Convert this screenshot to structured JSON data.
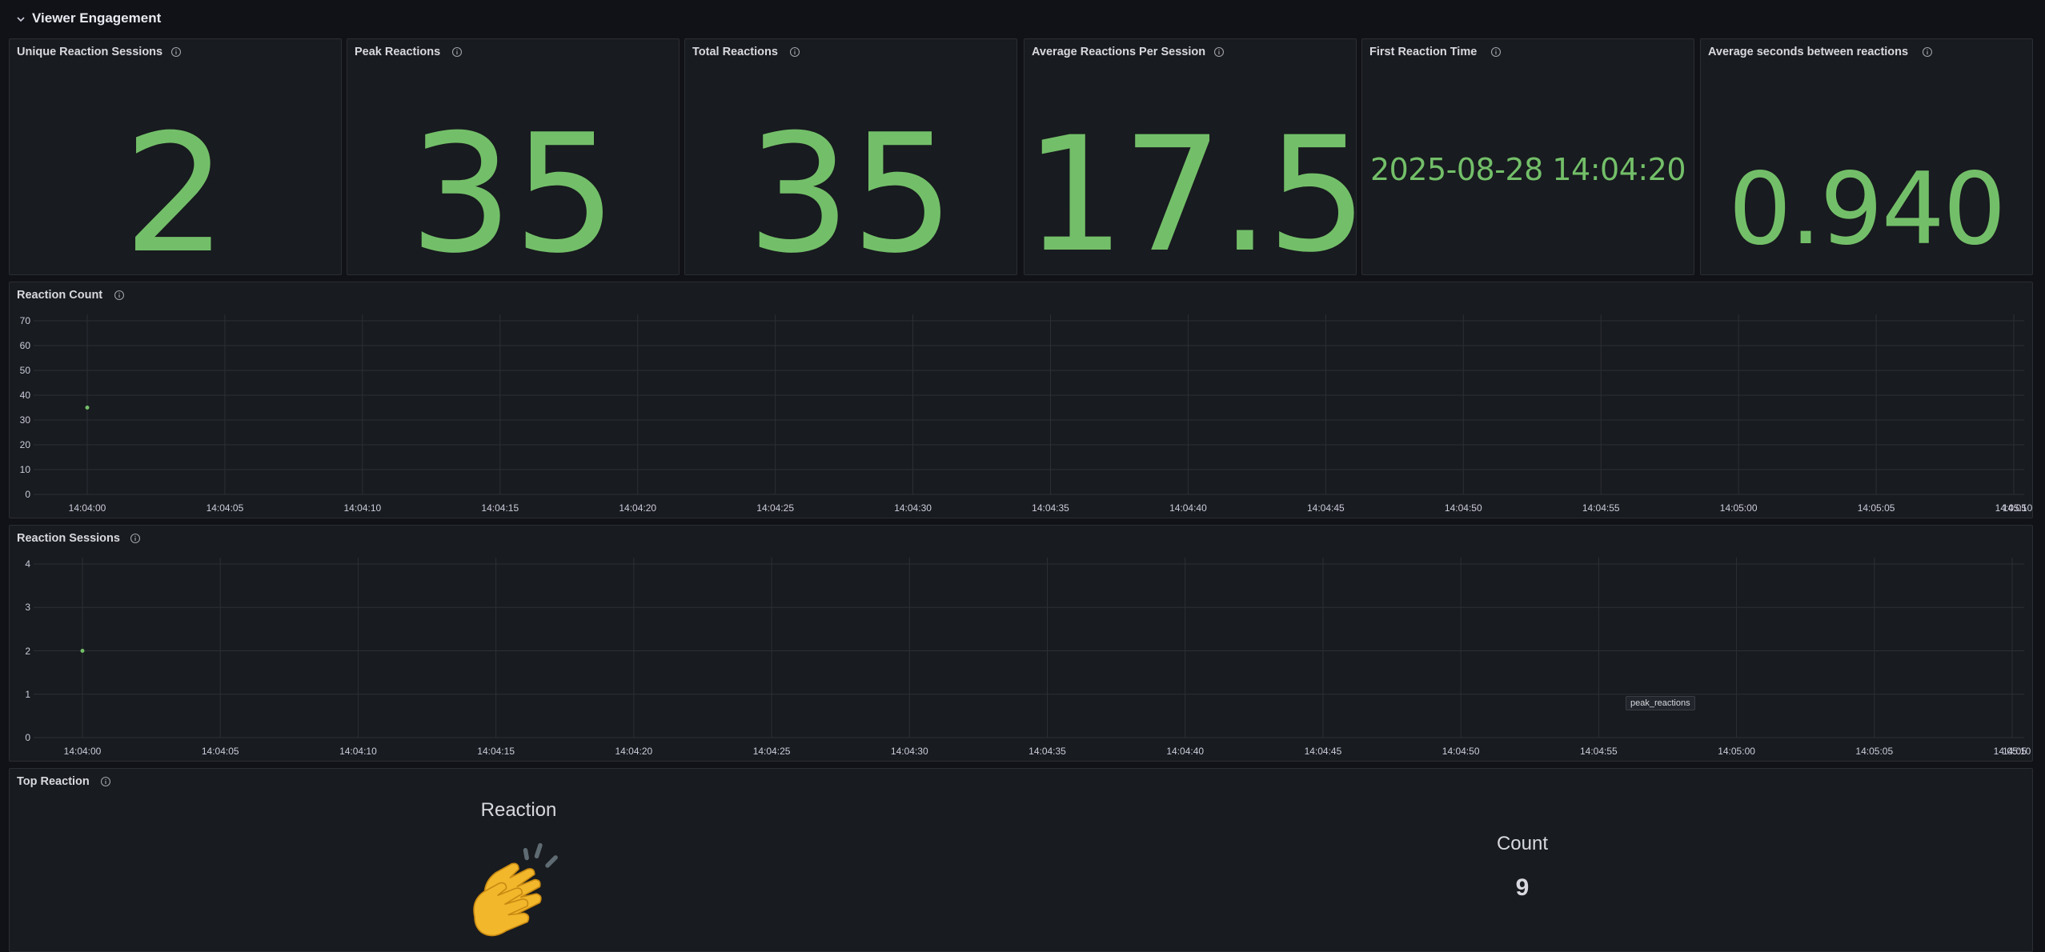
{
  "row": {
    "title": "Viewer Engagement"
  },
  "stats": [
    {
      "title": "Unique Reaction Sessions",
      "value": "2"
    },
    {
      "title": "Peak Reactions",
      "value": "35"
    },
    {
      "title": "Total Reactions",
      "value": "35"
    },
    {
      "title": "Average Reactions Per Session",
      "value": "17.5"
    },
    {
      "title": "First Reaction Time",
      "value": "2025-08-28 14:04:20"
    },
    {
      "title": "Average seconds between reactions",
      "value": "0.940"
    }
  ],
  "colors": {
    "accent": "#73bf69",
    "panel_bg": "#181b1f",
    "page_bg": "#111217",
    "grid": "#2c2f35"
  },
  "icons": {
    "row_toggle": "chevron-down-icon",
    "panel_info": "info-icon"
  },
  "chart_data": [
    {
      "type": "scatter",
      "title": "Reaction Count",
      "x_ticks": [
        "14:04:00",
        "14:04:05",
        "14:04:10",
        "14:04:15",
        "14:04:20",
        "14:04:25",
        "14:04:30",
        "14:04:35",
        "14:04:40",
        "14:04:45",
        "14:04:50",
        "14:04:55",
        "14:05:00",
        "14:05:05",
        "14:05:10",
        "14:05"
      ],
      "y_ticks": [
        "70",
        "60",
        "50",
        "40",
        "30",
        "20",
        "10",
        "0"
      ],
      "ylim": [
        0,
        70
      ],
      "grid": true,
      "points": [
        {
          "x": "14:04:00",
          "y": 35
        }
      ]
    },
    {
      "type": "scatter",
      "title": "Reaction Sessions",
      "x_ticks": [
        "14:04:00",
        "14:04:05",
        "14:04:10",
        "14:04:15",
        "14:04:20",
        "14:04:25",
        "14:04:30",
        "14:04:35",
        "14:04:40",
        "14:04:45",
        "14:04:50",
        "14:04:55",
        "14:05:00",
        "14:05:05",
        "14:05:10",
        "14:05"
      ],
      "y_ticks": [
        "4",
        "3",
        "2",
        "1",
        "0"
      ],
      "ylim": [
        0,
        4
      ],
      "grid": true,
      "points": [
        {
          "x": "14:04:00",
          "y": 2
        }
      ],
      "tooltip": "peak_reactions"
    }
  ],
  "top_reaction": {
    "title": "Top Reaction",
    "columns": [
      "Reaction",
      "Count"
    ],
    "reaction_emoji": "clapping-hands",
    "count": "9"
  }
}
